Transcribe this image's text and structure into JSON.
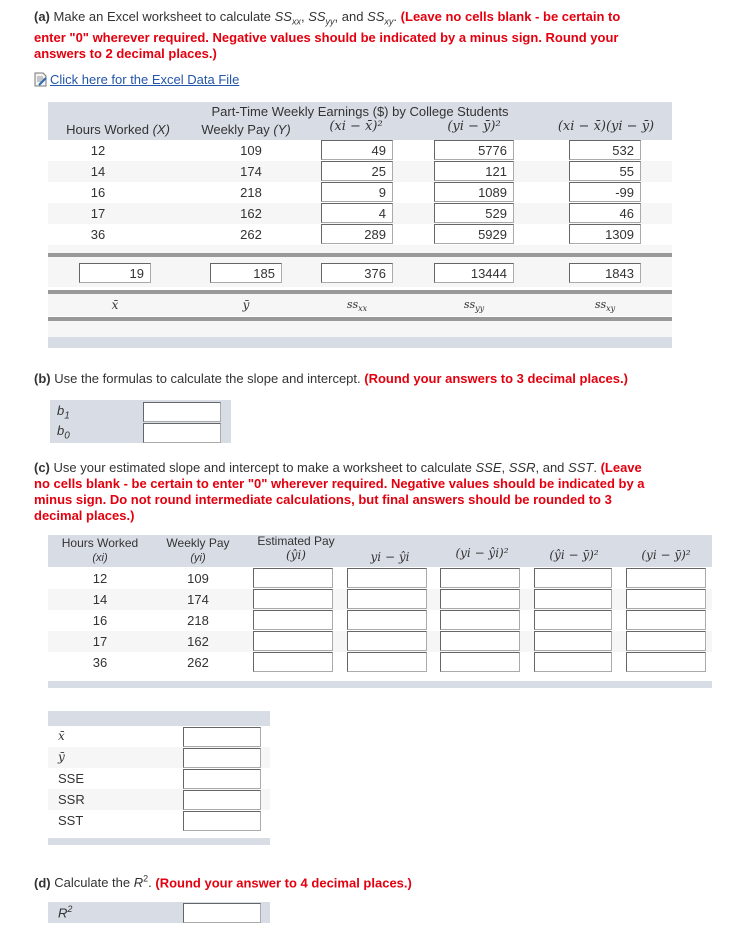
{
  "part_a": {
    "label": "(a)",
    "text": "Make an Excel worksheet to calculate SSxx, SSyy, and SSxy.",
    "instruction": "(Leave no cells blank - be certain to enter \"0\" wherever required. Negative values should be indicated by a minus sign. Round your answers to 2 decimal places.)",
    "excel_link": "Click here for the Excel Data File",
    "table_title": "Part-Time Weekly Earnings ($) by College Students",
    "headers": [
      "Hours Worked (X)",
      "Weekly Pay (Y)",
      "(xi − x̄)²",
      "(yi − ȳ)²",
      "(xi − x̄)(yi − ȳ)"
    ],
    "header_hours": "Hours Worked",
    "header_hours_var": "(X)",
    "header_pay": "Weekly Pay",
    "header_pay_var": "(Y)",
    "rows": [
      {
        "x": "12",
        "y": "109",
        "dx2": "49",
        "dy2": "5776",
        "dxdy": "532"
      },
      {
        "x": "14",
        "y": "174",
        "dx2": "25",
        "dy2": "121",
        "dxdy": "55"
      },
      {
        "x": "16",
        "y": "218",
        "dx2": "9",
        "dy2": "1089",
        "dxdy": "-99"
      },
      {
        "x": "17",
        "y": "162",
        "dx2": "4",
        "dy2": "529",
        "dxdy": "46"
      },
      {
        "x": "36",
        "y": "262",
        "dx2": "289",
        "dy2": "5929",
        "dxdy": "1309"
      }
    ],
    "totals": {
      "xbar": "19",
      "ybar": "185",
      "ssxx": "376",
      "ssyy": "13444",
      "ssxy": "1843"
    },
    "total_labels": [
      "x̄",
      "ȳ",
      "ssxx",
      "ssyy",
      "ssxy"
    ]
  },
  "part_b": {
    "label": "(b)",
    "text": "Use the formulas to calculate the slope and intercept.",
    "instruction": "(Round your answers to 3 decimal places.)",
    "fields": [
      {
        "label": "b1",
        "value": ""
      },
      {
        "label": "b0",
        "value": ""
      }
    ]
  },
  "part_c": {
    "label": "(c)",
    "text": "Use your estimated slope and intercept to make a worksheet to calculate SSE, SSR, and SST.",
    "instruction": "(Leave no cells blank - be certain to enter \"0\" wherever required. Negative values should be indicated by a minus sign. Do not round intermediate calculations, but final answers should be rounded to 3 decimal places.)",
    "headers": {
      "hours": "Hours Worked",
      "hours_var": "(xi)",
      "pay": "Weekly Pay",
      "pay_var": "(yi)",
      "est": "Estimated Pay",
      "est_var": "(ŷi)",
      "resid": "yi − ŷi",
      "resid_sq": "(yi − ŷi)²",
      "reg_sq": "(ŷi − ȳ)²",
      "tot_sq": "(yi − ȳ)²"
    },
    "rows": [
      {
        "x": "12",
        "y": "109"
      },
      {
        "x": "14",
        "y": "174"
      },
      {
        "x": "16",
        "y": "218"
      },
      {
        "x": "17",
        "y": "162"
      },
      {
        "x": "36",
        "y": "262"
      }
    ],
    "summary": [
      {
        "label": "x̄",
        "value": ""
      },
      {
        "label": "ȳ",
        "value": ""
      },
      {
        "label": "SSE",
        "value": ""
      },
      {
        "label": "SSR",
        "value": ""
      },
      {
        "label": "SST",
        "value": ""
      }
    ]
  },
  "part_d": {
    "label": "(d)",
    "text": "Calculate the R².",
    "instruction": "(Round your answer to 4 decimal places.)",
    "field_label": "R²",
    "value": ""
  }
}
